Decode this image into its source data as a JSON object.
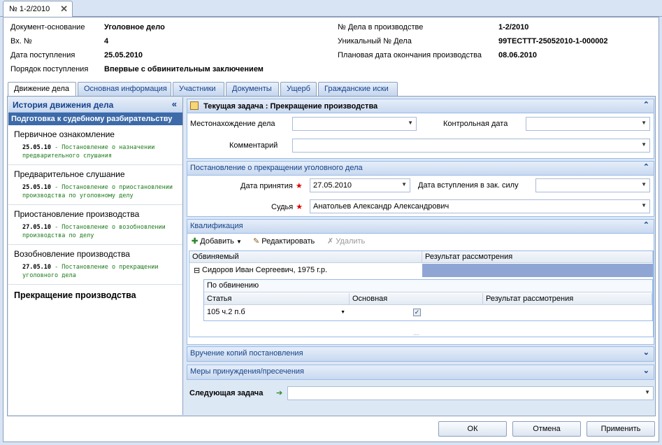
{
  "doc_tab": {
    "title": "№ 1-2/2010",
    "close": "✕"
  },
  "header": {
    "left": [
      {
        "label": "Документ-основание",
        "value": "Уголовное дело"
      },
      {
        "label": "Вх. №",
        "value": "4"
      },
      {
        "label": "Дата поступления",
        "value": "25.05.2010"
      },
      {
        "label": "Порядок поступления",
        "value": "Впервые с обвинительным заключением"
      }
    ],
    "right": [
      {
        "label": "№ Дела в производстве",
        "value": "1-2/2010"
      },
      {
        "label": "Уникальный № Дела",
        "value": "99TECTTT-25052010-1-000002"
      },
      {
        "label": "Плановая дата окончания производства",
        "value": "08.06.2010"
      }
    ]
  },
  "tabs": [
    "Движение дела",
    "Основная информация",
    "Участники",
    "Документы",
    "Ущерб",
    "Гражданские иски"
  ],
  "history": {
    "title": "История движения дела",
    "collapse": "«",
    "selected": "Подготовка к судебному разбирательству",
    "stages": [
      {
        "title": "Первичное ознакомление",
        "date": "25.05.10",
        "note": " - Постановление о назначении предварительного слушания"
      },
      {
        "title": "Предварительное слушание",
        "date": "25.05.10",
        "note": " - Постановление о приостановлении производства по уголовному делу"
      },
      {
        "title": "Приостановление производства",
        "date": "27.05.10",
        "note": " - Постановление о возобновлении производства по делу"
      },
      {
        "title": "Возобновление производства",
        "date": "27.05.10",
        "note": " - Постановление о прекращении уголовного дела"
      }
    ],
    "final": "Прекращение производства"
  },
  "current_task": {
    "title": "Текущая задача : Прекращение производства",
    "location_label": "Местонахождение дела",
    "location_value": "",
    "control_date_label": "Контрольная дата",
    "control_date_value": "",
    "comment_label": "Комментарий",
    "comment_value": ""
  },
  "decision": {
    "title": "Постановление о прекращении уголовного дела",
    "date_label": "Дата принятия",
    "date_value": "27.05.2010",
    "effective_label": "Дата вступления в зак. силу",
    "effective_value": "",
    "judge_label": "Судья",
    "judge_value": "Анатольев Александр Александрович"
  },
  "qualification": {
    "title": "Квалификация",
    "toolbar": {
      "add": "Добавить",
      "edit": "Редактировать",
      "delete": "Удалить"
    },
    "columns": [
      "Обвиняемый",
      "Результат рассмотрения"
    ],
    "defendant": "Сидоров Иван Сергеевич, 1975 г.р.",
    "sub_title": "По обвинению",
    "sub_columns": [
      "Статья",
      "Основная",
      "Результат рассмотрения"
    ],
    "sub_row": {
      "article": "105 ч.2 п.б",
      "main": true,
      "result": ""
    }
  },
  "collapsed_panels": [
    "Вручение копий постановления",
    "Меры принуждения/пресечения"
  ],
  "next_task": {
    "label": "Следующая задача",
    "value": ""
  },
  "buttons": {
    "ok": "ОК",
    "cancel": "Отмена",
    "apply": "Применить"
  }
}
